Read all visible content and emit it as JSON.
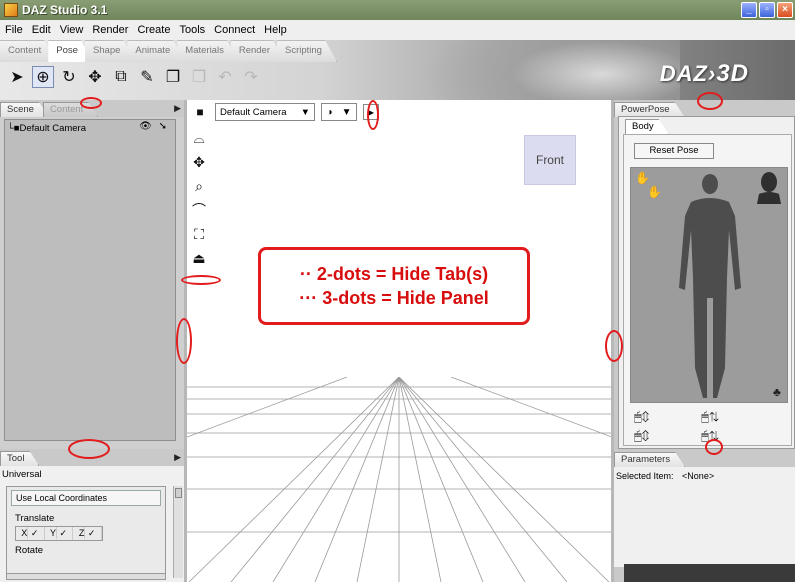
{
  "window": {
    "title": "DAZ Studio 3.1"
  },
  "menu": [
    "File",
    "Edit",
    "View",
    "Render",
    "Create",
    "Tools",
    "Connect",
    "Help"
  ],
  "main_tabs": [
    "Content",
    "Pose",
    "Shape",
    "Animate",
    "Materials",
    "Render",
    "Scripting"
  ],
  "brand": {
    "logo_a": "DAZ",
    "logo_b": "3D"
  },
  "left_panel": {
    "tabs": [
      "Scene",
      "Content"
    ],
    "scene_items": [
      "Default Camera"
    ]
  },
  "tool_panel": {
    "tab": "Tool",
    "mode": "Universal",
    "use_local_label": "Use Local Coordinates",
    "translate_label": "Translate",
    "axes": [
      "X",
      "Y",
      "Z"
    ],
    "rotate_label": "Rotate"
  },
  "viewport": {
    "camera": "Default Camera",
    "view_cube_label": "Front",
    "callout_line1": "·· 2-dots = Hide Tab(s)",
    "callout_line2": "··· 3-dots = Hide Panel"
  },
  "right_panel": {
    "tab": "PowerPose",
    "subtab": "Body",
    "reset_label": "Reset Pose"
  },
  "param_panel": {
    "tab": "Parameters",
    "selected_label": "Selected Item:",
    "selected_value": "<None>"
  },
  "colors": {
    "annotation_red": "#e21c1c",
    "title_bar": "#7a8f66"
  }
}
